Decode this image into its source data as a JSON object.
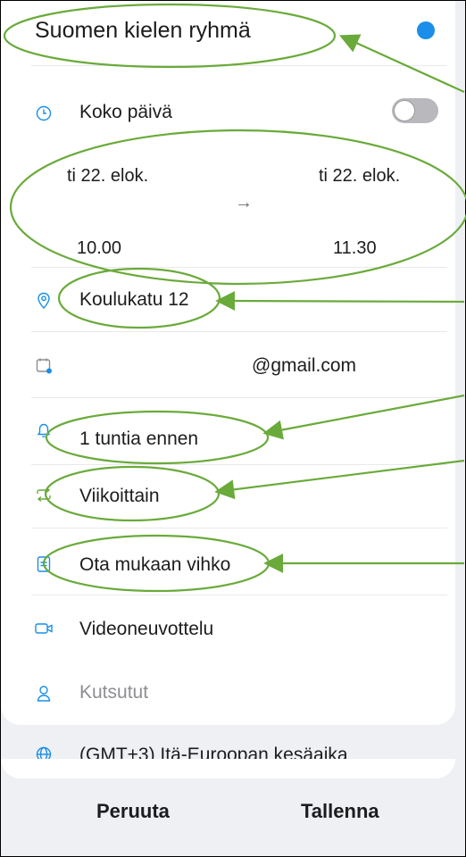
{
  "event": {
    "title": "Suomen kielen ryhmä",
    "color": "#1a8ee8"
  },
  "all_day": {
    "label": "Koko päivä",
    "on": false
  },
  "time": {
    "start_date": "ti 22. elok.",
    "start_time": "10.00",
    "arrow": "→",
    "end_date": "ti 22. elok.",
    "end_time": "11.30"
  },
  "location": {
    "value": "Koulukatu 12",
    "icon": "location-pin-icon"
  },
  "calendar": {
    "value": "@gmail.com",
    "icon": "calendar-icon"
  },
  "reminder": {
    "value": "1 tuntia ennen",
    "icon": "bell-icon"
  },
  "repeat": {
    "value": "Viikoittain",
    "icon": "repeat-icon"
  },
  "notes": {
    "value": "Ota mukaan vihko",
    "icon": "note-icon"
  },
  "video": {
    "value": "Videoneuvottelu",
    "icon": "video-icon"
  },
  "invitees": {
    "placeholder": "Kutsutut",
    "icon": "person-icon"
  },
  "timezone": {
    "value": "(GMT+3) Itä-Euroopan kesäaika",
    "icon": "globe-icon"
  },
  "footer": {
    "cancel": "Peruuta",
    "save": "Tallenna"
  },
  "colors": {
    "annotation": "#6aaa3a",
    "icon": "#8a8d92",
    "accent": "#1a8ee8"
  }
}
